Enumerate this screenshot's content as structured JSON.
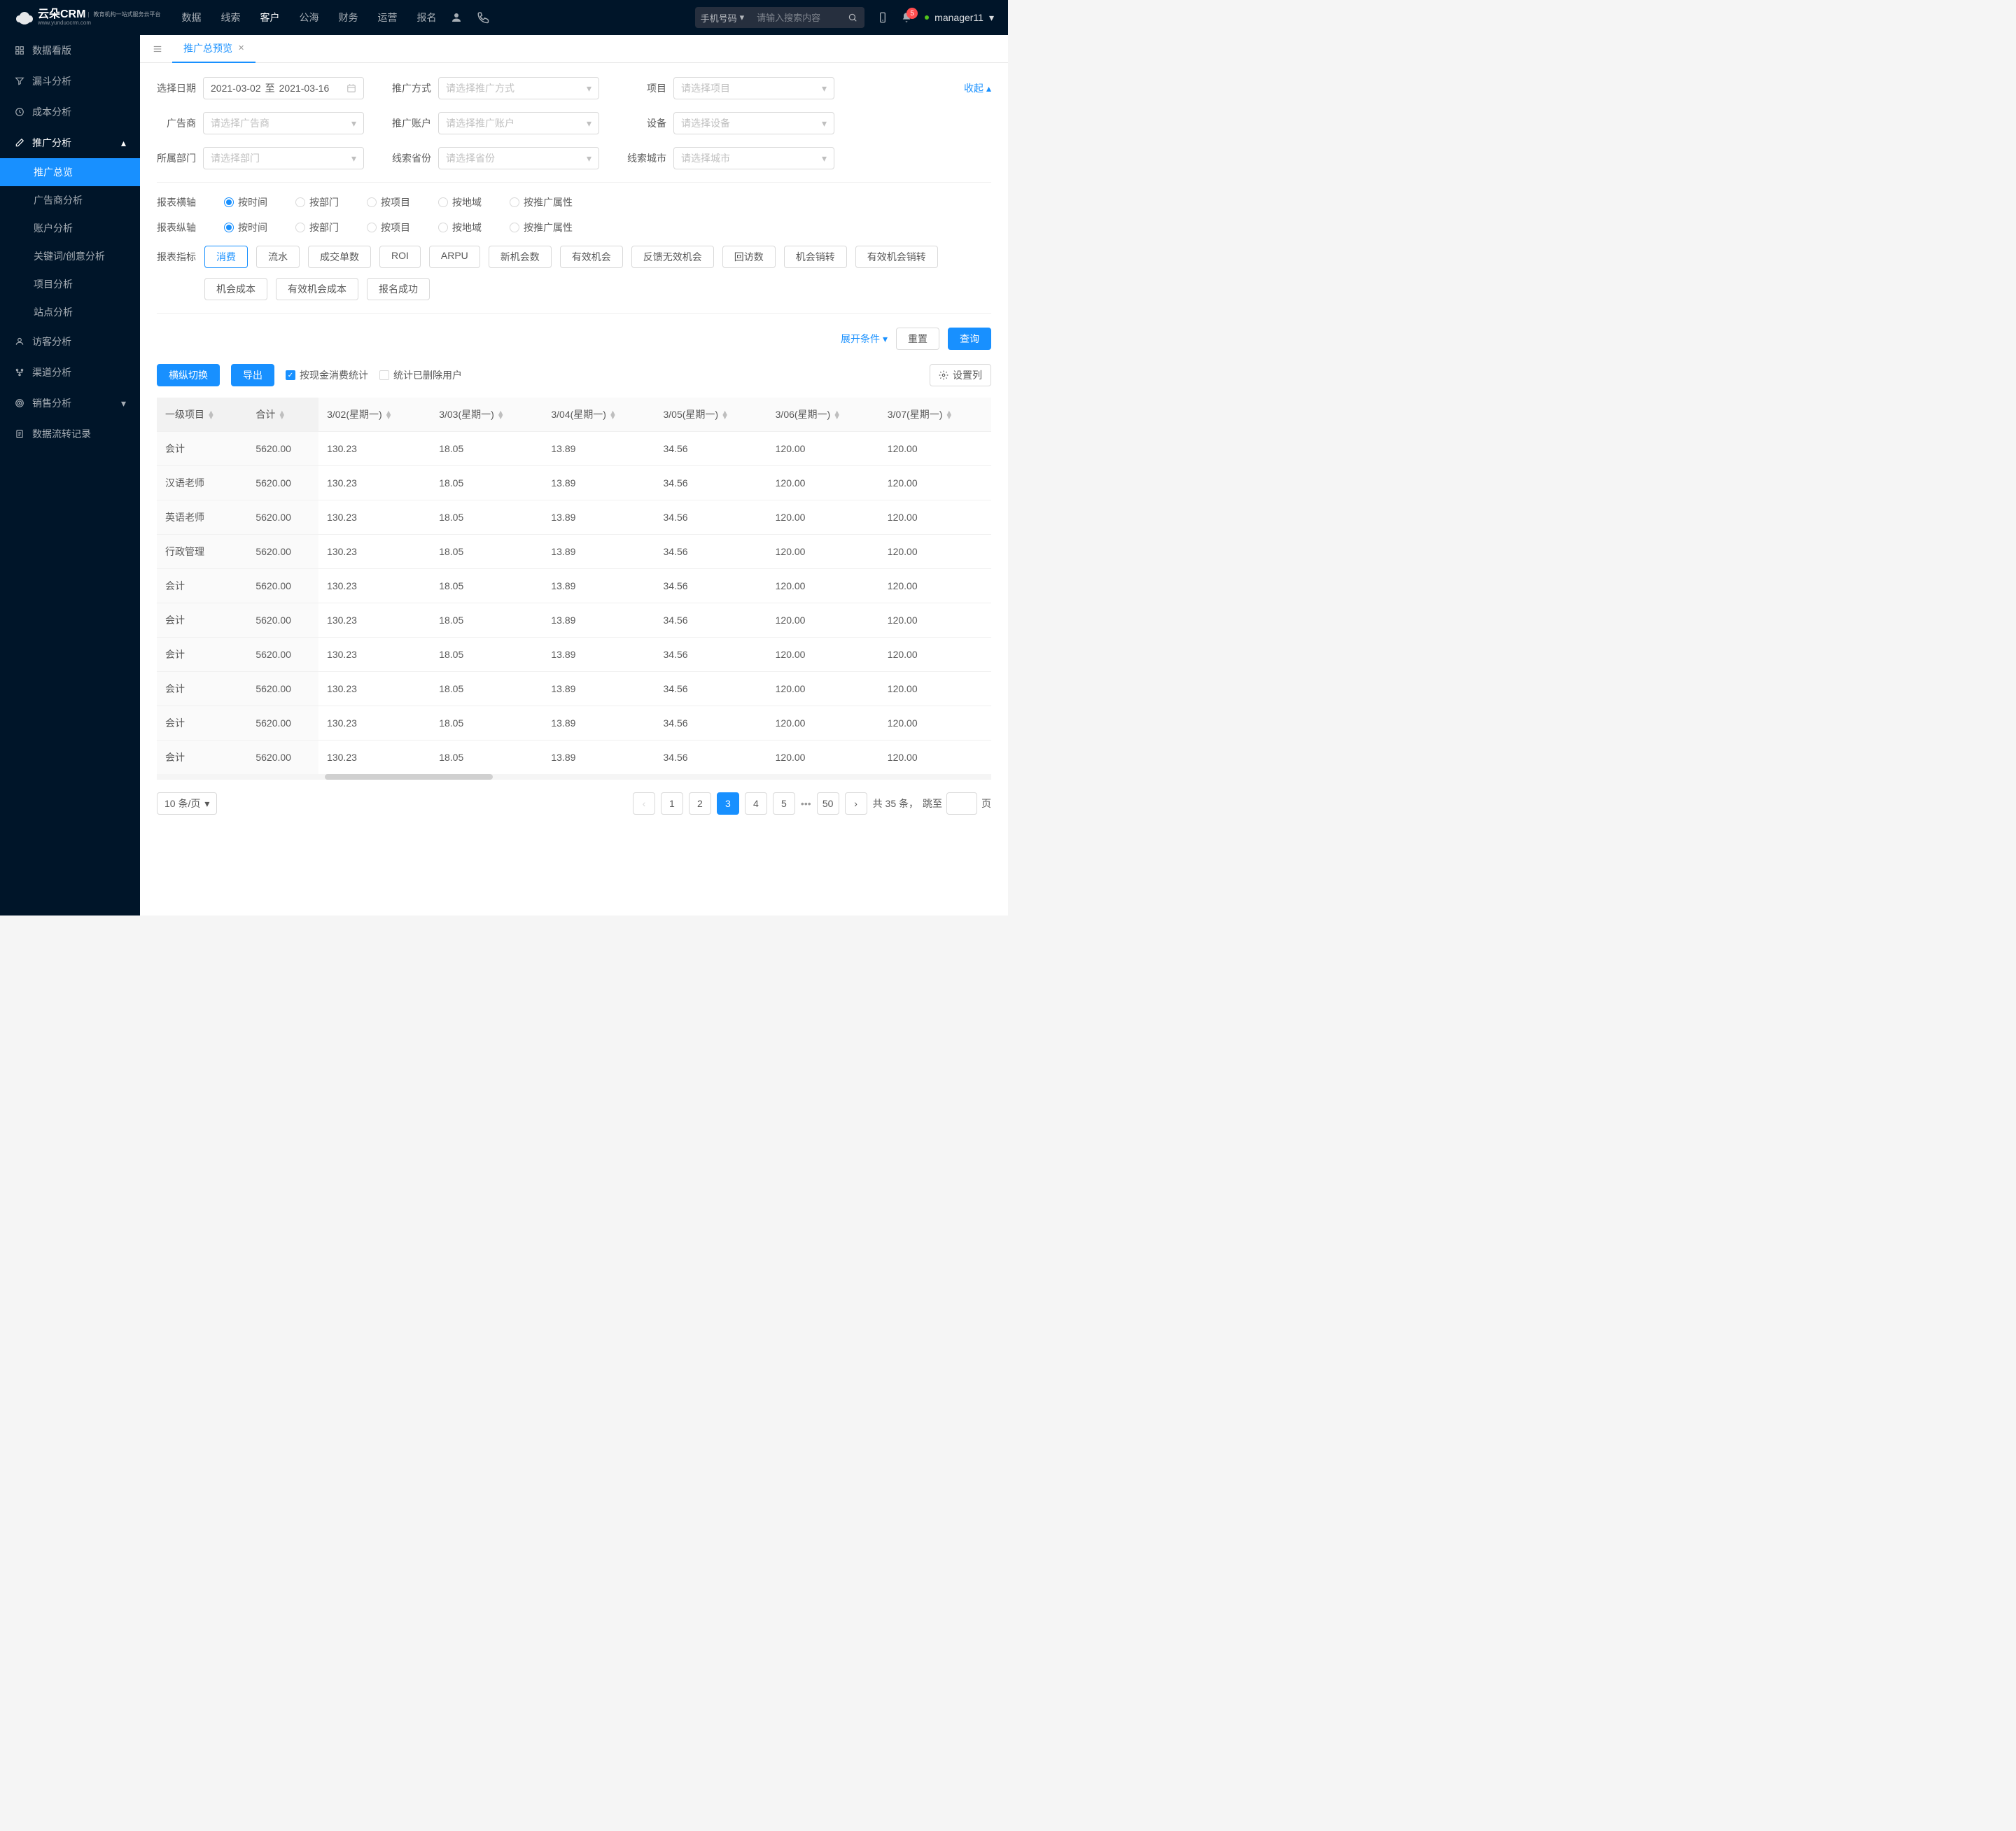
{
  "header": {
    "logo_main": "云朵CRM",
    "logo_sub_url": "www.yunduocrm.com",
    "logo_sub_desc": "教育机构一站式服务云平台",
    "nav": [
      "数据",
      "线索",
      "客户",
      "公海",
      "财务",
      "运营",
      "报名"
    ],
    "nav_active_index": 2,
    "search_type": "手机号码",
    "search_placeholder": "请输入搜索内容",
    "notification_count": "5",
    "username": "manager11"
  },
  "sidebar": {
    "items": [
      {
        "icon": "dashboard",
        "label": "数据看版"
      },
      {
        "icon": "funnel",
        "label": "漏斗分析"
      },
      {
        "icon": "clock",
        "label": "成本分析"
      },
      {
        "icon": "edit",
        "label": "推广分析",
        "expandable": true,
        "expanded": true,
        "active_parent": true,
        "children": [
          {
            "label": "推广总览",
            "active": true
          },
          {
            "label": "广告商分析"
          },
          {
            "label": "账户分析"
          },
          {
            "label": "关键词/创意分析"
          },
          {
            "label": "项目分析"
          },
          {
            "label": "站点分析"
          }
        ]
      },
      {
        "icon": "user",
        "label": "访客分析"
      },
      {
        "icon": "channel",
        "label": "渠道分析"
      },
      {
        "icon": "target",
        "label": "销售分析",
        "expandable": true
      },
      {
        "icon": "doc",
        "label": "数据流转记录"
      }
    ]
  },
  "tab": {
    "label": "推广总预览"
  },
  "filters": {
    "date_label": "选择日期",
    "date_from": "2021-03-02",
    "date_to": "2021-03-16",
    "date_sep": "至",
    "method_label": "推广方式",
    "method_placeholder": "请选择推广方式",
    "project_label": "项目",
    "project_placeholder": "请选择项目",
    "advertiser_label": "广告商",
    "advertiser_placeholder": "请选择广告商",
    "account_label": "推广账户",
    "account_placeholder": "请选择推广账户",
    "device_label": "设备",
    "device_placeholder": "请选择设备",
    "department_label": "所属部门",
    "department_placeholder": "请选择部门",
    "province_label": "线索省份",
    "province_placeholder": "请选择省份",
    "city_label": "线索城市",
    "city_placeholder": "请选择城市",
    "collapse": "收起"
  },
  "axis": {
    "h_label": "报表横轴",
    "v_label": "报表纵轴",
    "options": [
      "按时间",
      "按部门",
      "按项目",
      "按地域",
      "按推广属性"
    ],
    "h_active": 0,
    "v_active": 0
  },
  "metrics": {
    "label": "报表指标",
    "row1": [
      "消费",
      "流水",
      "成交单数",
      "ROI",
      "ARPU",
      "新机会数",
      "有效机会",
      "反馈无效机会",
      "回访数",
      "机会销转",
      "有效机会销转"
    ],
    "row2": [
      "机会成本",
      "有效机会成本",
      "报名成功"
    ],
    "active_index": 0
  },
  "actions": {
    "expand": "展开条件",
    "reset": "重置",
    "query": "查询"
  },
  "toolbar": {
    "switch": "横纵切换",
    "export": "导出",
    "chk1": "按现金消费统计",
    "chk2": "统计已删除用户",
    "settings": "设置列"
  },
  "table": {
    "headers": [
      "一级项目",
      "合计",
      "3/02(星期一)",
      "3/03(星期一)",
      "3/04(星期一)",
      "3/05(星期一)",
      "3/06(星期一)",
      "3/07(星期一)"
    ],
    "rows": [
      {
        "c0": "会计",
        "c1": "5620.00",
        "c2": "130.23",
        "c3": "18.05",
        "c4": "13.89",
        "c5": "34.56",
        "c6": "120.00",
        "c7": "120.00"
      },
      {
        "c0": "汉语老师",
        "c1": "5620.00",
        "c2": "130.23",
        "c3": "18.05",
        "c4": "13.89",
        "c5": "34.56",
        "c6": "120.00",
        "c7": "120.00"
      },
      {
        "c0": "英语老师",
        "c1": "5620.00",
        "c2": "130.23",
        "c3": "18.05",
        "c4": "13.89",
        "c5": "34.56",
        "c6": "120.00",
        "c7": "120.00"
      },
      {
        "c0": "行政管理",
        "c1": "5620.00",
        "c2": "130.23",
        "c3": "18.05",
        "c4": "13.89",
        "c5": "34.56",
        "c6": "120.00",
        "c7": "120.00"
      },
      {
        "c0": "会计",
        "c1": "5620.00",
        "c2": "130.23",
        "c3": "18.05",
        "c4": "13.89",
        "c5": "34.56",
        "c6": "120.00",
        "c7": "120.00"
      },
      {
        "c0": "会计",
        "c1": "5620.00",
        "c2": "130.23",
        "c3": "18.05",
        "c4": "13.89",
        "c5": "34.56",
        "c6": "120.00",
        "c7": "120.00"
      },
      {
        "c0": "会计",
        "c1": "5620.00",
        "c2": "130.23",
        "c3": "18.05",
        "c4": "13.89",
        "c5": "34.56",
        "c6": "120.00",
        "c7": "120.00"
      },
      {
        "c0": "会计",
        "c1": "5620.00",
        "c2": "130.23",
        "c3": "18.05",
        "c4": "13.89",
        "c5": "34.56",
        "c6": "120.00",
        "c7": "120.00"
      },
      {
        "c0": "会计",
        "c1": "5620.00",
        "c2": "130.23",
        "c3": "18.05",
        "c4": "13.89",
        "c5": "34.56",
        "c6": "120.00",
        "c7": "120.00"
      },
      {
        "c0": "会计",
        "c1": "5620.00",
        "c2": "130.23",
        "c3": "18.05",
        "c4": "13.89",
        "c5": "34.56",
        "c6": "120.00",
        "c7": "120.00"
      }
    ]
  },
  "pagination": {
    "size": "10 条/页",
    "pages": [
      "1",
      "2",
      "3",
      "4",
      "5"
    ],
    "page_last": "50",
    "active_index": 2,
    "total_prefix": "共 35 条，",
    "jump_label": "跳至",
    "jump_suffix": "页"
  },
  "icons": {
    "chevron_down": "▾",
    "chevron_up": "▴",
    "chevron_left": "‹",
    "chevron_right": "›"
  }
}
